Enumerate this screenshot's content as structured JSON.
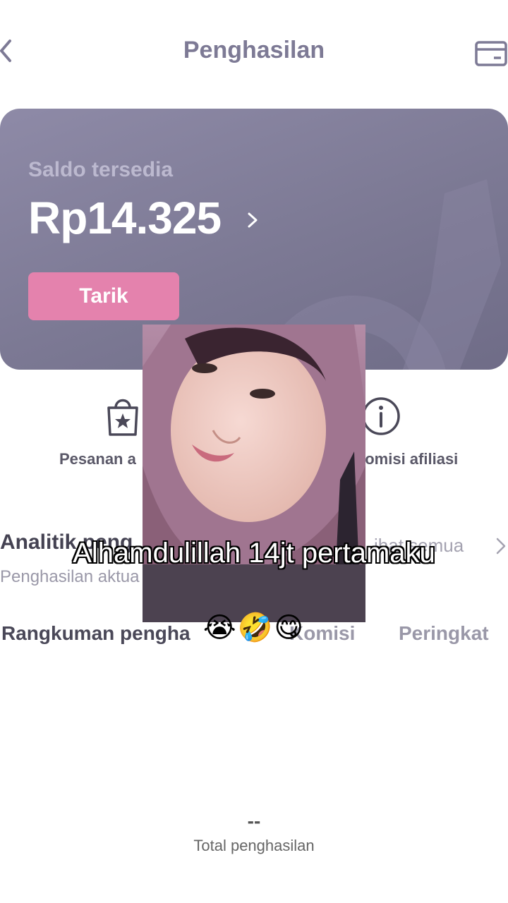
{
  "header": {
    "title": "Penghasilan",
    "back_icon": "chevron-left-icon",
    "right_icon": "card-icon"
  },
  "balance": {
    "label": "Saldo tersedia",
    "amount": "Rp14.325",
    "withdraw_label": "Tarik"
  },
  "quick_actions": [
    {
      "label": "Pesanan a",
      "icon": "shopping-bag-star-icon"
    },
    {
      "label": "komisi afiliasi",
      "icon": "info-icon"
    }
  ],
  "analytics": {
    "title": "Analitik peng",
    "subtitle": "Penghasilan aktua",
    "see_all": "ihat semua"
  },
  "tabs": [
    {
      "label": "Rangkuman pengha",
      "active": true
    },
    {
      "label": "Komisi",
      "active": false
    },
    {
      "label": "Peringkat",
      "active": false
    }
  ],
  "summary": {
    "total_value": "--",
    "total_label": "Total penghasilan"
  },
  "overlay": {
    "caption": "Alhamdulillah 14jt pertamaku",
    "emojis": "😭🤣😋"
  },
  "colors": {
    "accent": "#e482ad",
    "card": "#7c7994",
    "title": "#7d7a95"
  }
}
